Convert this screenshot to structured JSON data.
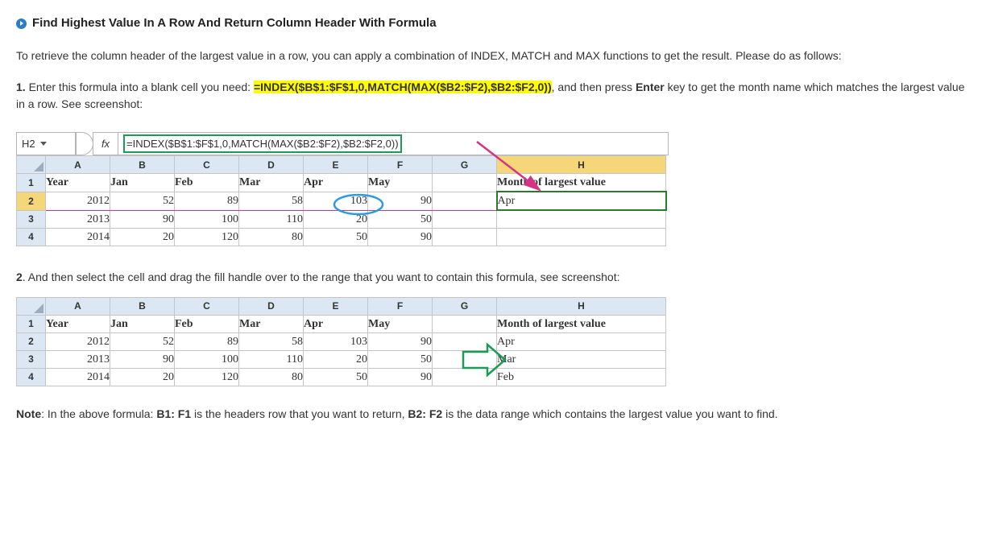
{
  "heading": "Find Highest Value In A Row And Return Column Header With Formula",
  "intro": "To retrieve the column header of the largest value in a row, you can apply a combination of INDEX, MATCH and MAX functions to get the result. Please do as follows:",
  "step1_a": "1. ",
  "step1_b": "Enter this formula into a blank cell you need: ",
  "formula_hl": "=INDEX($B$1:$F$1,0,MATCH(MAX($B2:$F2),$B2:$F2,0))",
  "step1_c": ", and then press ",
  "enter": "Enter",
  "step1_d": " key to get the month name which matches the largest value in a row. See screenshot:",
  "namebox": "H2",
  "fx_label": "fx",
  "formula_box": "=INDEX($B$1:$F$1,0,MATCH(MAX($B2:$F2),$B2:$F2,0))",
  "cols": {
    "A": "A",
    "B": "B",
    "C": "C",
    "D": "D",
    "E": "E",
    "F": "F",
    "G": "G",
    "H": "H"
  },
  "rows": {
    "r1": "1",
    "r2": "2",
    "r3": "3",
    "r4": "4"
  },
  "hdr": {
    "year": "Year",
    "jan": "Jan",
    "feb": "Feb",
    "mar": "Mar",
    "apr": "Apr",
    "may": "May",
    "g": "",
    "h": "Month of largest value"
  },
  "t1": {
    "r2": {
      "a": "2012",
      "b": "52",
      "c": "89",
      "d": "58",
      "e": "103",
      "f": "90",
      "g": "",
      "h": "Apr"
    },
    "r3": {
      "a": "2013",
      "b": "90",
      "c": "100",
      "d": "110",
      "e": "20",
      "f": "50",
      "g": "",
      "h": ""
    },
    "r4": {
      "a": "2014",
      "b": "20",
      "c": "120",
      "d": "80",
      "e": "50",
      "f": "90",
      "g": "",
      "h": ""
    }
  },
  "step2_a": "2",
  "step2_b": ". And then select the cell and drag the fill handle over to the range that you want to contain this formula, see screenshot:",
  "t2": {
    "r2": {
      "a": "2012",
      "b": "52",
      "c": "89",
      "d": "58",
      "e": "103",
      "f": "90",
      "g": "",
      "h": "Apr"
    },
    "r3": {
      "a": "2013",
      "b": "90",
      "c": "100",
      "d": "110",
      "e": "20",
      "f": "50",
      "g": "",
      "h": "Mar"
    },
    "r4": {
      "a": "2014",
      "b": "20",
      "c": "120",
      "d": "80",
      "e": "50",
      "f": "90",
      "g": "",
      "h": "Feb"
    }
  },
  "note_a": "Note",
  "note_b": ": In the above formula: ",
  "note_c": "B1: F1",
  "note_d": " is the headers row that you want to return, ",
  "note_e": "B2: F2",
  "note_f": " is the data range which contains the largest value you want to find."
}
